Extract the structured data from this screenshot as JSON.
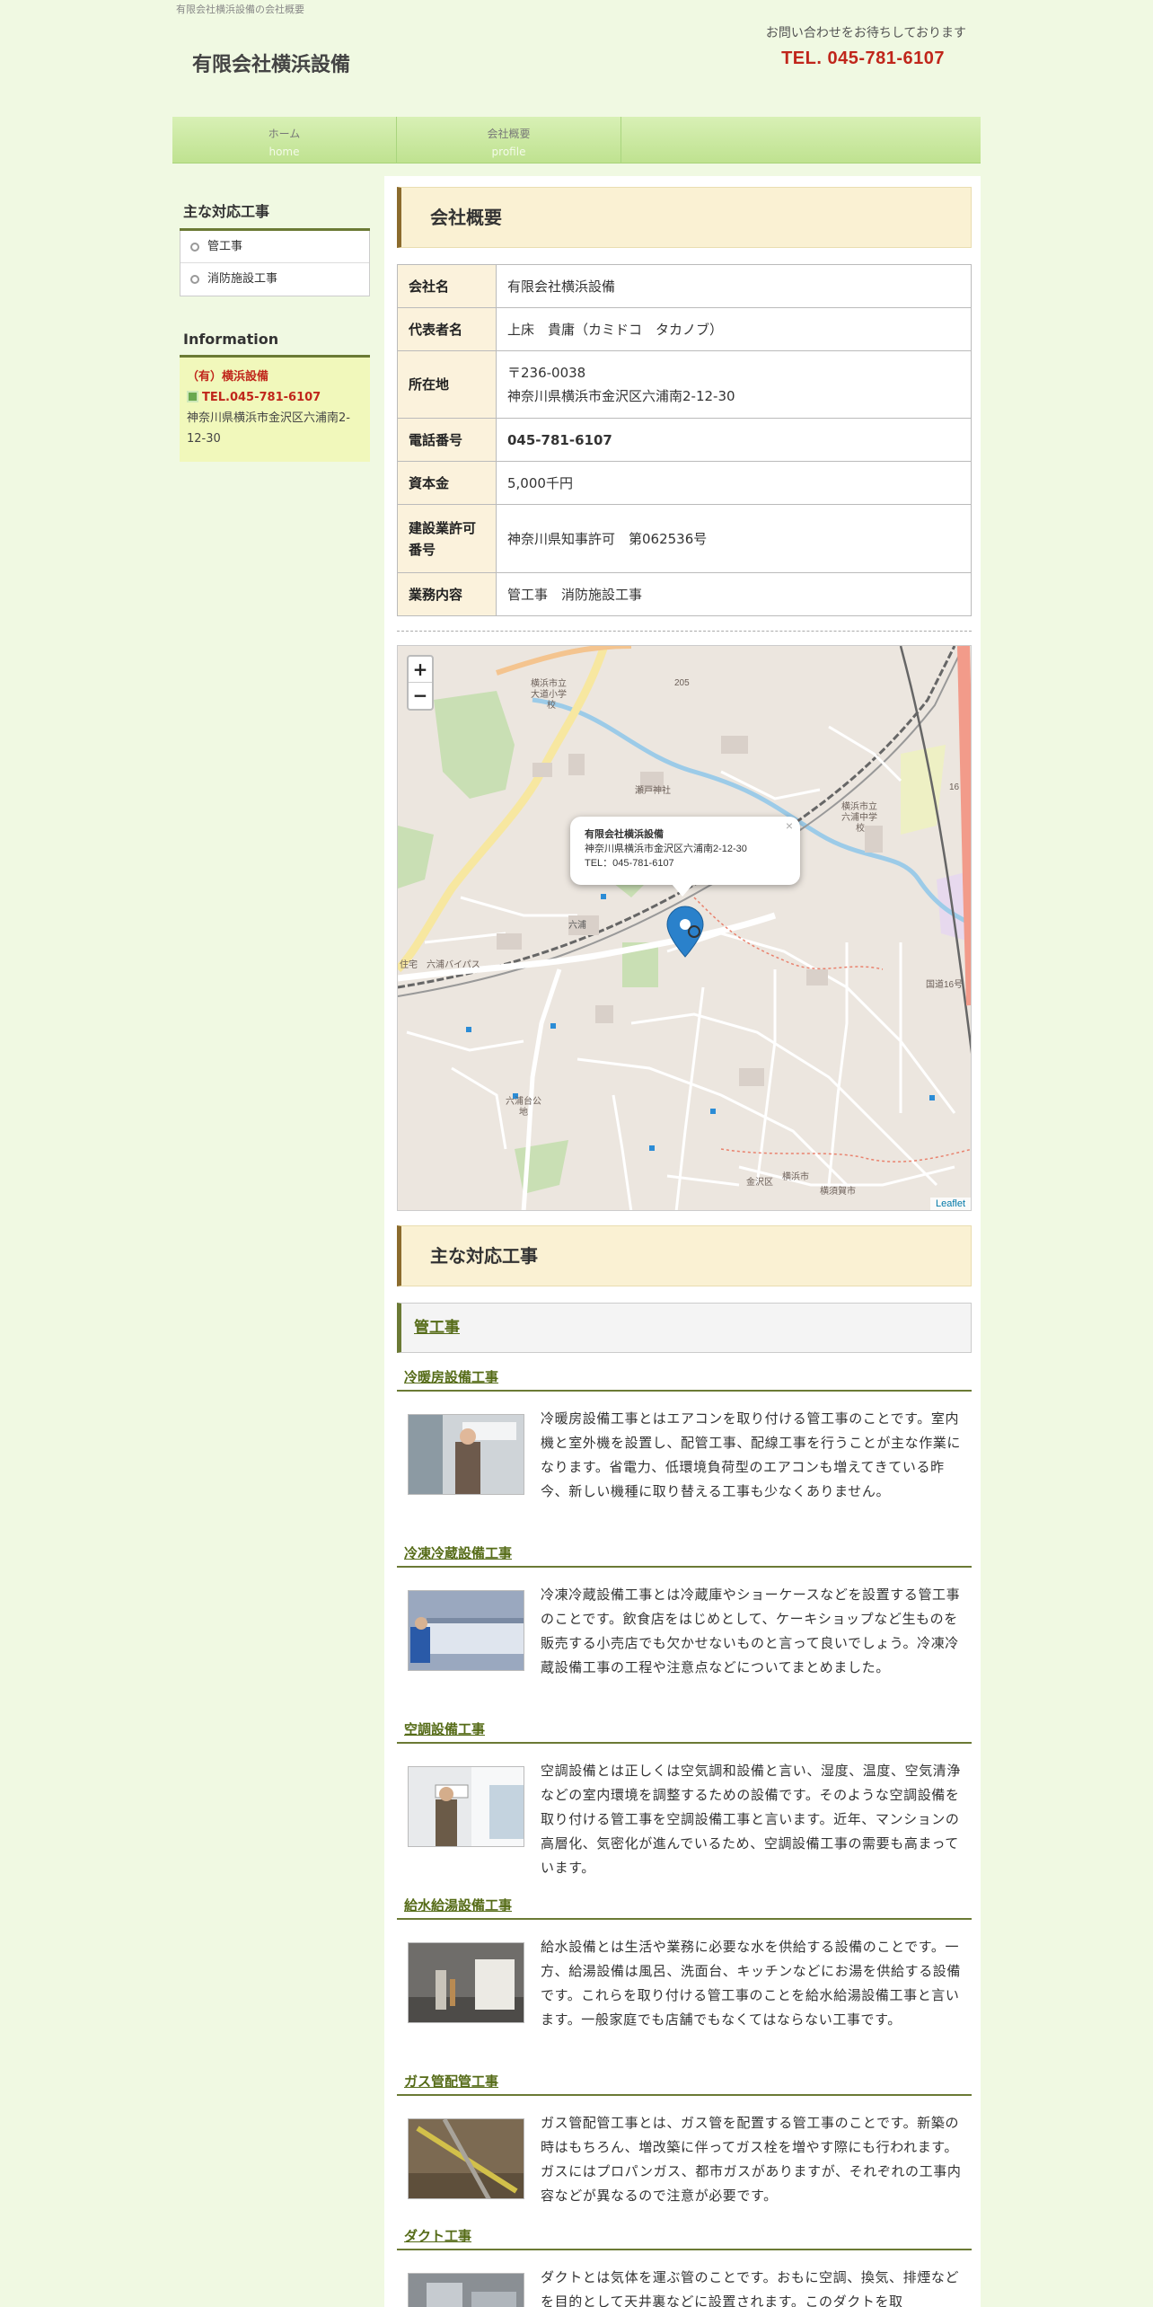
{
  "header": {
    "tagline": "有限会社横浜設備の会社概要",
    "site_title": "有限会社横浜設備",
    "contact_msg": "お問い合わせをお待ちしております",
    "contact_tel": "TEL. 045-781-6107"
  },
  "nav": [
    {
      "label": "ホーム",
      "sub": "home"
    },
    {
      "label": "会社概要",
      "sub": "profile"
    }
  ],
  "sidebar": {
    "works_title": "主な対応工事",
    "works": [
      "管工事",
      "消防施設工事"
    ],
    "info_title": "Information",
    "info_name": "（有）横浜設備",
    "info_tel": "TEL.045-781-6107",
    "info_addr": "神奈川県横浜市金沢区六浦南2-12-30"
  },
  "main": {
    "company_title": "会社概要",
    "company": {
      "rows": [
        {
          "key": "会社名",
          "value": "有限会社横浜設備"
        },
        {
          "key": "代表者名",
          "value": "上床　貴庸（カミドコ　タカノブ）"
        },
        {
          "key": "所在地",
          "value": "〒236-0038",
          "value2": "神奈川県横浜市金沢区六浦南2-12-30"
        },
        {
          "key": "電話番号",
          "value": "045-781-6107"
        },
        {
          "key": "資本金",
          "value": "5,000千円"
        },
        {
          "key": "建設業許可番号",
          "value": "神奈川県知事許可　第062536号"
        },
        {
          "key": "業務内容",
          "value": "管工事　消防施設工事"
        }
      ]
    },
    "map": {
      "zoom_in": "+",
      "zoom_out": "−",
      "popup_name": "有限会社横浜設備",
      "popup_addr": "神奈川県横浜市金沢区六浦南2-12-30",
      "popup_tel": "TEL：045-781-6107",
      "popup_close": "×",
      "attribution": "Leaflet",
      "labels": {
        "school1": "横浜市立",
        "school1b": "大道小学",
        "school1c": "校",
        "route": "205",
        "shrine": "瀬戸神社",
        "school2": "横浜市立",
        "school2b": "六浦中学",
        "school2c": "校",
        "road16": "16",
        "station": "六浦",
        "bypass": "住宅　六浦バイパス",
        "park": "六浦台公",
        "parkb": "地",
        "road_east": "国道16号",
        "kanazawa": "金沢区",
        "yokosuka": "横浜市",
        "yokosuka2": "横須賀市"
      }
    },
    "works_title": "主な対応工事",
    "sub_title": "管工事",
    "items": [
      {
        "title": "冷暖房設備工事",
        "text": "冷暖房設備工事とはエアコンを取り付ける管工事のことです。室内機と室外機を設置し、配管工事、配線工事を行うことが主な作業になります。省電力、低環境負荷型のエアコンも増えてきている昨今、新しい機種に取り替える工事も少なくありません。"
      },
      {
        "title": "冷凍冷蔵設備工事",
        "text": "冷凍冷蔵設備工事とは冷蔵庫やショーケースなどを設置する管工事のことです。飲食店をはじめとして、ケーキショップなど生ものを販売する小売店でも欠かせないものと言って良いでしょう。冷凍冷蔵設備工事の工程や注意点などについてまとめました。"
      },
      {
        "title": "空調設備工事",
        "text": "空調設備とは正しくは空気調和設備と言い、湿度、温度、空気清浄などの室内環境を調整するための設備です。そのような空調設備を取り付ける管工事を空調設備工事と言います。近年、マンションの高層化、気密化が進んでいるため、空調設備工事の需要も高まっています。"
      },
      {
        "title": "給水給湯設備工事",
        "text": "給水設備とは生活や業務に必要な水を供給する設備のことです。一方、給湯設備は風呂、洗面台、キッチンなどにお湯を供給する設備です。これらを取り付ける管工事のことを給水給湯設備工事と言います。一般家庭でも店舗でもなくてはならない工事です。"
      },
      {
        "title": "ガス管配管工事",
        "text": "ガス管配管工事とは、ガス管を配置する管工事のことです。新築の時はもちろん、増改築に伴ってガス栓を増やす際にも行われます。ガスにはプロパンガス、都市ガスがありますが、それぞれの工事内容などが異なるので注意が必要です。"
      },
      {
        "title": "ダクト工事",
        "text": "ダクトとは気体を運ぶ管のことです。おもに空調、換気、排煙などを目的として天井裏などに設置されます。このダクトを取"
      }
    ]
  }
}
